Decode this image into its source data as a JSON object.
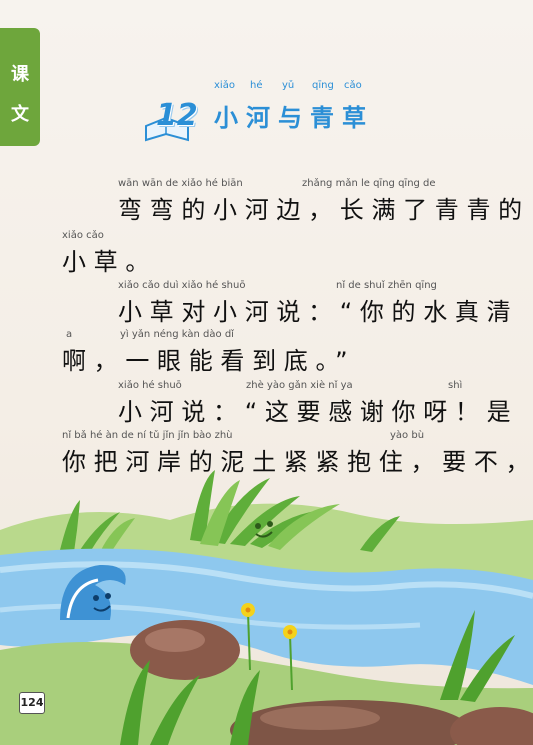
{
  "section_tab": [
    "课",
    "文"
  ],
  "lesson": {
    "number": "12",
    "pinyin": [
      "xiǎo",
      "hé",
      "yǔ",
      "qīng",
      "cǎo"
    ],
    "title": [
      "小",
      "河",
      "与",
      "青",
      "草"
    ]
  },
  "lines": [
    {
      "pinyin": [
        "wān wān de xiǎo hé biān",
        "zhǎng mǎn le qīng qīng de"
      ],
      "text": "弯弯的小河边，长满了青青的"
    },
    {
      "pinyin": [
        "xiǎo cǎo"
      ],
      "text": "小草。"
    },
    {
      "pinyin": [
        "xiǎo cǎo duì xiǎo hé shuō",
        "nǐ de shuǐ zhēn qīng"
      ],
      "text": "小草对小河说：“你的水真清"
    },
    {
      "pinyin": [
        "a",
        "yì yǎn néng kàn dào dǐ"
      ],
      "text": "啊，一眼能看到底。”"
    },
    {
      "pinyin": [
        "xiǎo hé shuō",
        "zhè yào gǎn xiè nǐ ya",
        "shì"
      ],
      "text": "小河说：“这要感谢你呀！是"
    },
    {
      "pinyin": [
        "nǐ bǎ hé àn de ní tǔ jǐn jǐn bào zhù",
        "yào bù"
      ],
      "text": "你把河岸的泥土紧紧抱住，要不，"
    }
  ],
  "page_number": "124"
}
